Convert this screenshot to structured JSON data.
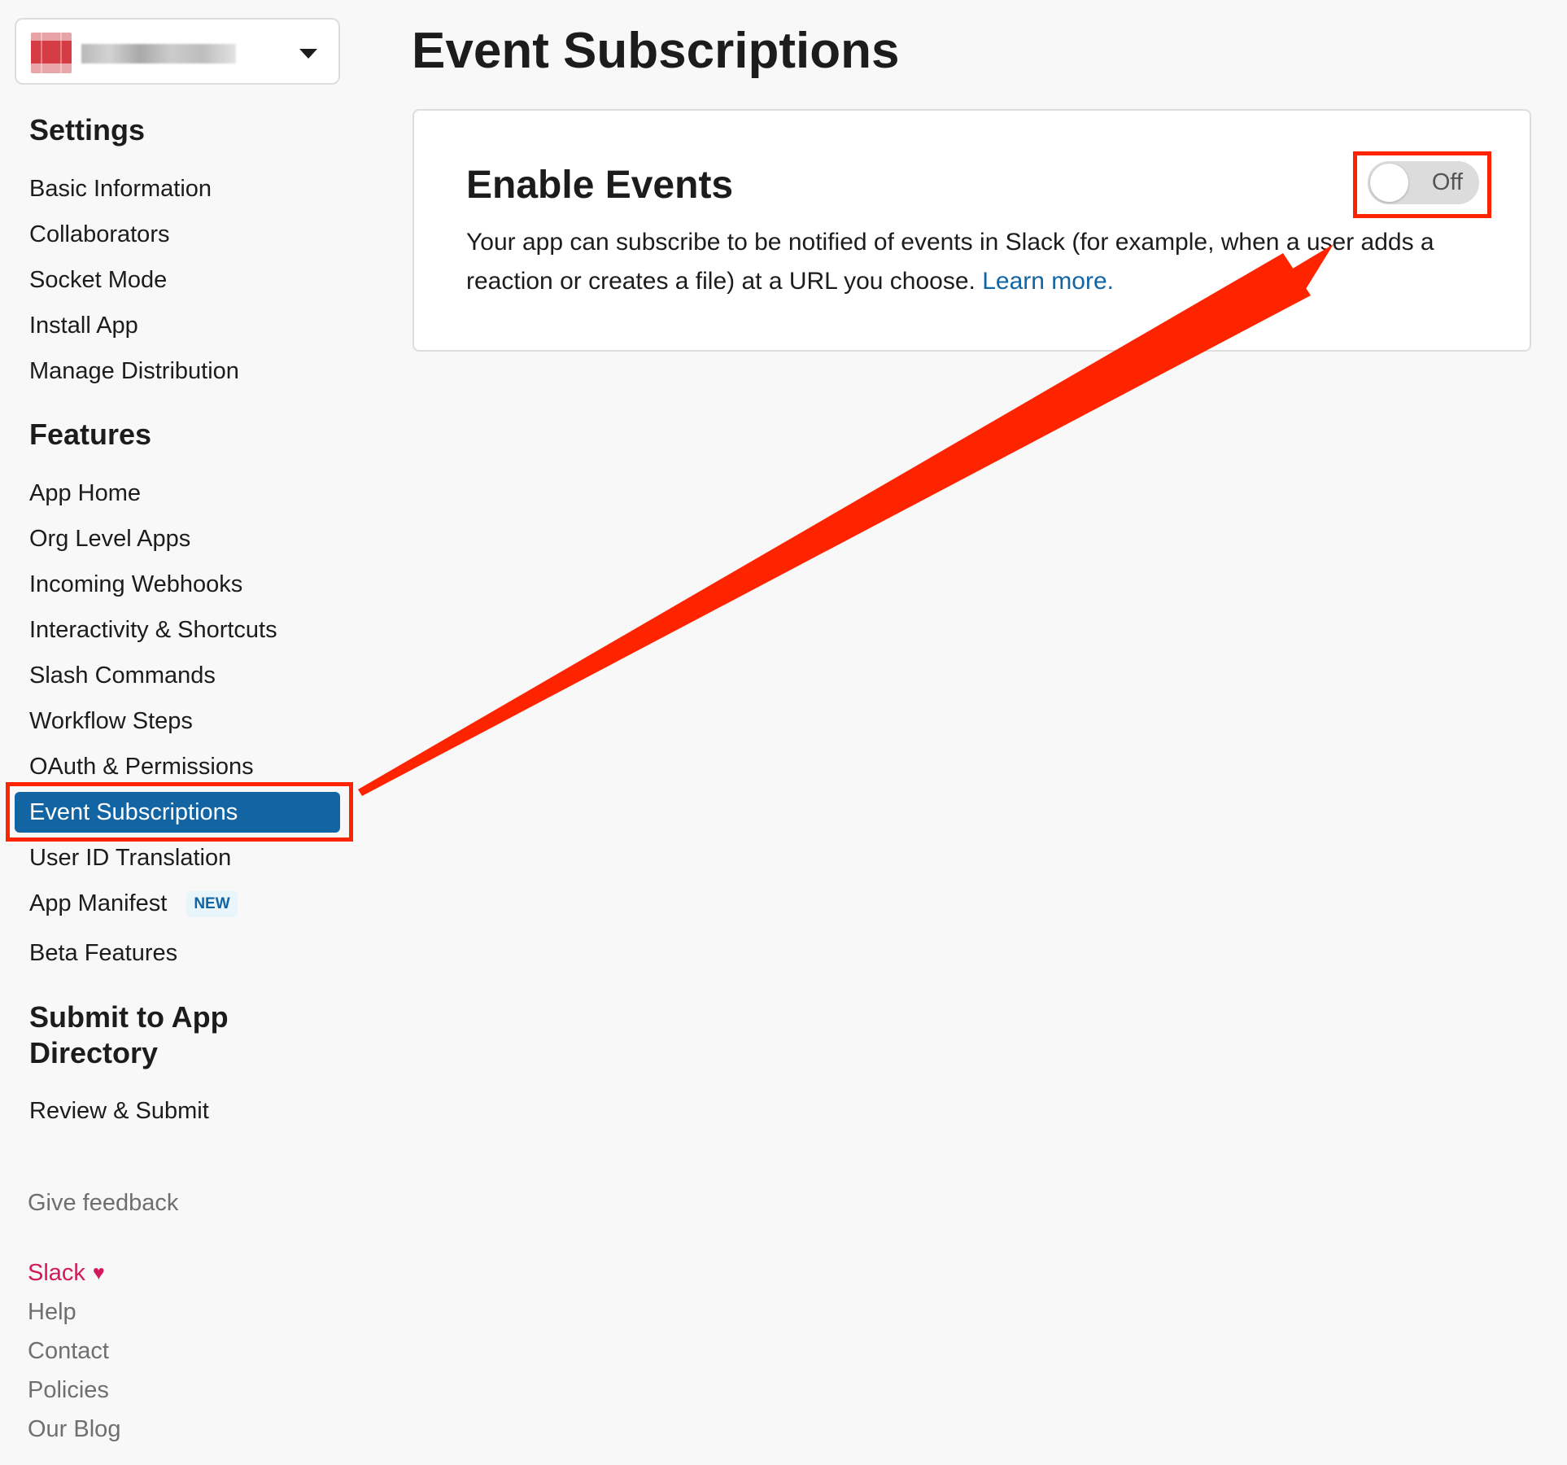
{
  "page": {
    "title": "Event Subscriptions"
  },
  "colors": {
    "accent_blue": "#1264a3",
    "annotation_red": "#ff2400",
    "slack_pink": "#d21a5c"
  },
  "app_switcher": {
    "icon": "blurred-app-icon",
    "name_obscured": true,
    "caret_icon": "chevron-down-icon"
  },
  "sidebar": {
    "settings": {
      "title": "Settings",
      "items": [
        "Basic Information",
        "Collaborators",
        "Socket Mode",
        "Install App",
        "Manage Distribution"
      ]
    },
    "features": {
      "title": "Features",
      "items": [
        "App Home",
        "Org Level Apps",
        "Incoming Webhooks",
        "Interactivity & Shortcuts",
        "Slash Commands",
        "Workflow Steps",
        "OAuth & Permissions",
        "Event Subscriptions",
        "User ID Translation",
        "App Manifest",
        "Beta Features"
      ],
      "active_item": "Event Subscriptions",
      "new_badge": "NEW"
    },
    "submit": {
      "title_line1": "Submit to App",
      "title_line2": "Directory",
      "items": [
        "Review & Submit"
      ]
    },
    "feedback": "Give feedback",
    "footer": [
      "Slack",
      "Help",
      "Contact",
      "Policies",
      "Our Blog"
    ],
    "footer_icon": "heart-icon"
  },
  "card": {
    "title": "Enable Events",
    "description": "Your app can subscribe to be notified of events in Slack (for example, when a user adds a reaction or creates a file) at a URL you choose. ",
    "learn_more": "Learn more.",
    "toggle_label": "Off",
    "toggle_state": "off"
  },
  "annotations": {
    "arrow": "red-arrow",
    "highlight": "red-highlight-box"
  }
}
